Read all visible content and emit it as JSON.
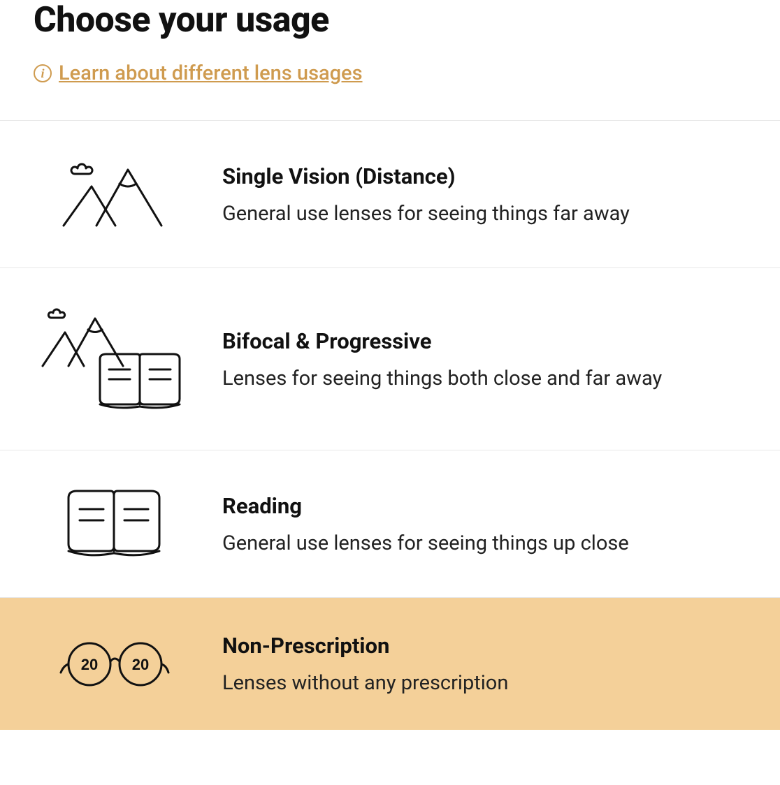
{
  "header": {
    "title": "Choose your usage",
    "learn_link": "Learn about different lens usages"
  },
  "options": [
    {
      "icon": "mountain-icon",
      "title": "Single Vision (Distance)",
      "desc": "General use lenses for seeing things far away",
      "selected": false
    },
    {
      "icon": "mountain-book-icon",
      "title": "Bifocal & Progressive",
      "desc": "Lenses for seeing things both close and far away",
      "selected": false
    },
    {
      "icon": "book-icon",
      "title": "Reading",
      "desc": "General use lenses for seeing things up close",
      "selected": false
    },
    {
      "icon": "glasses-2020-icon",
      "title": "Non-Prescription",
      "desc": "Lenses without any prescription",
      "selected": true
    }
  ],
  "glasses_text": {
    "left": "20",
    "right": "20"
  }
}
